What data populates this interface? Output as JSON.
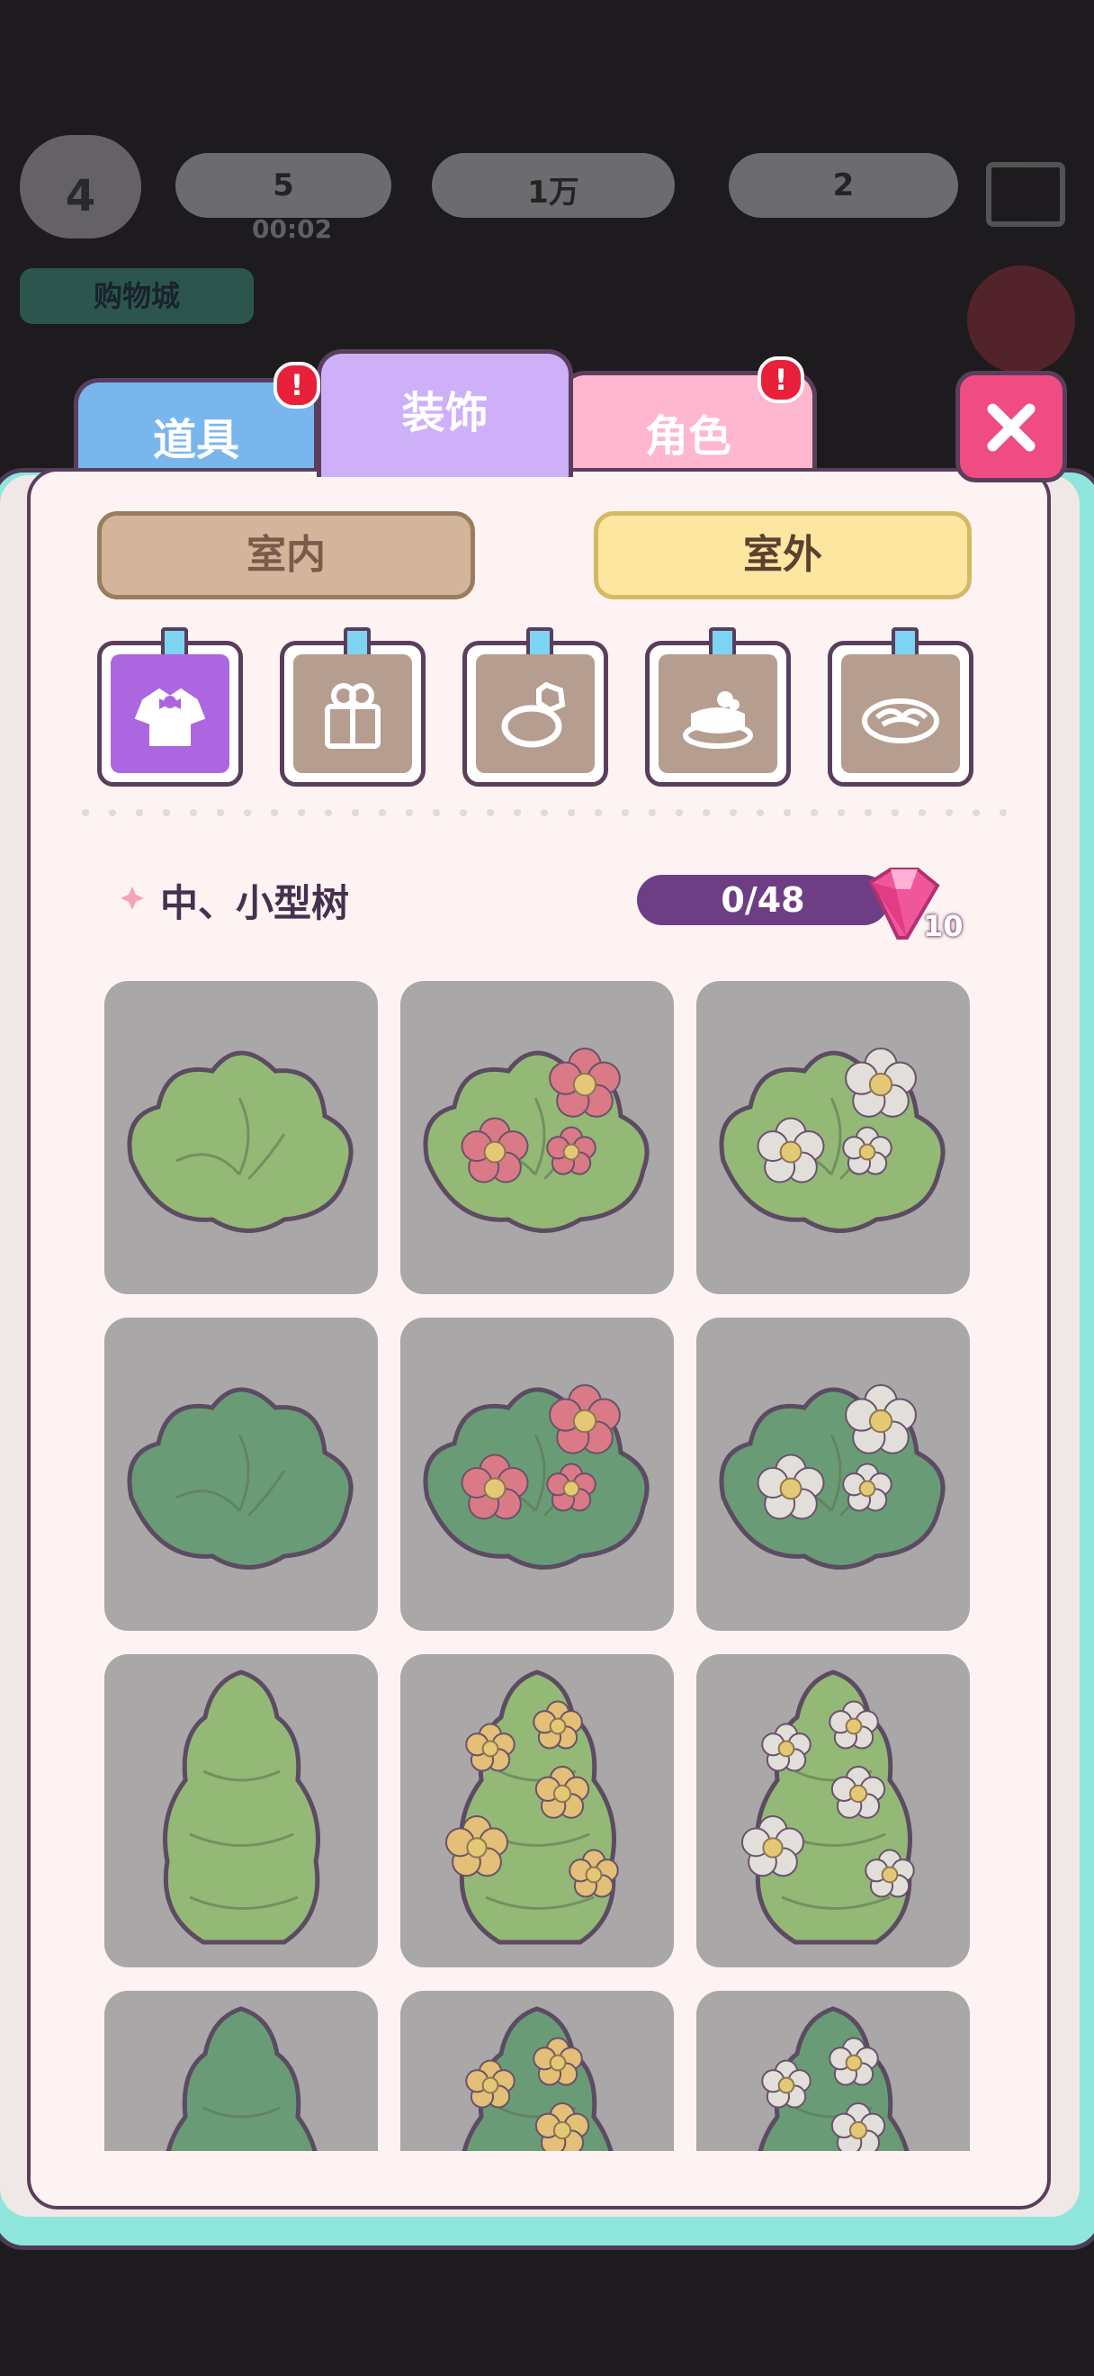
{
  "hud": {
    "level": "4",
    "energy": "5",
    "timer": "00:02",
    "coins": "1万",
    "gems": "2",
    "shop_label": "购物城"
  },
  "tabs": [
    {
      "label": "道具",
      "badge": "!"
    },
    {
      "label": "装饰"
    },
    {
      "label": "角色",
      "badge": "!"
    }
  ],
  "segments": {
    "indoor": "室内",
    "outdoor": "室外",
    "selected": "outdoor"
  },
  "categories": [
    {
      "icon": "dress-icon",
      "active": true
    },
    {
      "icon": "gift-icon",
      "active": false
    },
    {
      "icon": "ring-icon",
      "active": false
    },
    {
      "icon": "cake-icon",
      "active": false
    },
    {
      "icon": "pasta-icon",
      "active": false
    }
  ],
  "section": {
    "title": "中、小型树",
    "progress": "0/48",
    "reward": "10"
  },
  "items": [
    {
      "name": "round-bush-light",
      "shape": "round",
      "leaf": "light",
      "flower": "none"
    },
    {
      "name": "round-bush-light-pink",
      "shape": "round",
      "leaf": "light",
      "flower": "pink"
    },
    {
      "name": "round-bush-light-white",
      "shape": "round",
      "leaf": "light",
      "flower": "white"
    },
    {
      "name": "round-bush-dark",
      "shape": "round",
      "leaf": "dark",
      "flower": "none"
    },
    {
      "name": "round-bush-dark-pink",
      "shape": "round",
      "leaf": "dark",
      "flower": "pink"
    },
    {
      "name": "round-bush-dark-white",
      "shape": "round",
      "leaf": "dark",
      "flower": "white"
    },
    {
      "name": "tall-tree-light",
      "shape": "tall",
      "leaf": "light",
      "flower": "none"
    },
    {
      "name": "tall-tree-light-yellow",
      "shape": "tall",
      "leaf": "light",
      "flower": "yellow"
    },
    {
      "name": "tall-tree-light-white",
      "shape": "tall",
      "leaf": "light",
      "flower": "white"
    },
    {
      "name": "tall-tree-dark",
      "shape": "tall",
      "leaf": "dark",
      "flower": "none"
    },
    {
      "name": "tall-tree-dark-yellow",
      "shape": "tall",
      "leaf": "dark",
      "flower": "yellow"
    },
    {
      "name": "tall-tree-dark-white",
      "shape": "tall",
      "leaf": "dark",
      "flower": "white"
    }
  ],
  "colors": {
    "leaf_light": "#8fbd6a",
    "leaf_dark": "#5a9a6a",
    "flower_pink": "#e7707e",
    "flower_white": "#f1eee8",
    "flower_yellow": "#f2c66c"
  }
}
